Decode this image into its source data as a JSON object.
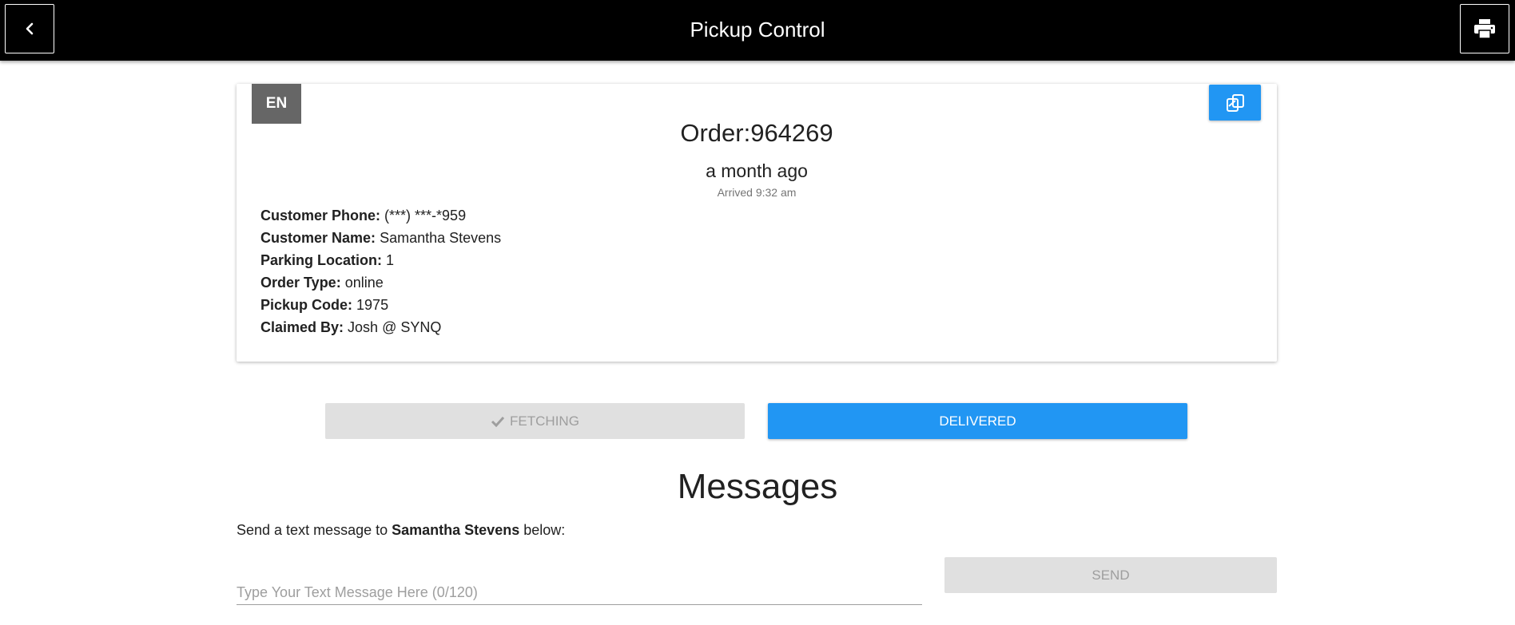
{
  "header": {
    "title": "Pickup Control",
    "back_icon": "chevron-left-icon",
    "print_icon": "print-icon"
  },
  "order": {
    "language_badge": "EN",
    "copy_icon": "copy-icon",
    "title": "Order:964269",
    "age": "a month ago",
    "arrived": "Arrived 9:32 am",
    "details": [
      {
        "label": "Customer Phone:",
        "value": "(***) ***-*959"
      },
      {
        "label": "Customer Name:",
        "value": "Samantha Stevens"
      },
      {
        "label": "Parking Location:",
        "value": "1"
      },
      {
        "label": "Order Type:",
        "value": "online"
      },
      {
        "label": "Pickup Code:",
        "value": "1975"
      },
      {
        "label": "Claimed By:",
        "value": "Josh @ SYNQ"
      }
    ]
  },
  "actions": {
    "fetching_label": "FETCHING",
    "fetching_icon": "check-icon",
    "delivered_label": "DELIVERED"
  },
  "messages": {
    "heading": "Messages",
    "instruction_prefix": "Send a text message to",
    "recipient": "Samantha Stevens",
    "instruction_suffix": "below:",
    "placeholder": "Type Your Text Message Here (0/120)",
    "send_label": "SEND"
  },
  "colors": {
    "topbar": "#000000",
    "accent": "#2196f3",
    "disabled_bg": "#e0e0e0",
    "disabled_text": "#9e9e9e",
    "badge_bg": "#666666"
  }
}
